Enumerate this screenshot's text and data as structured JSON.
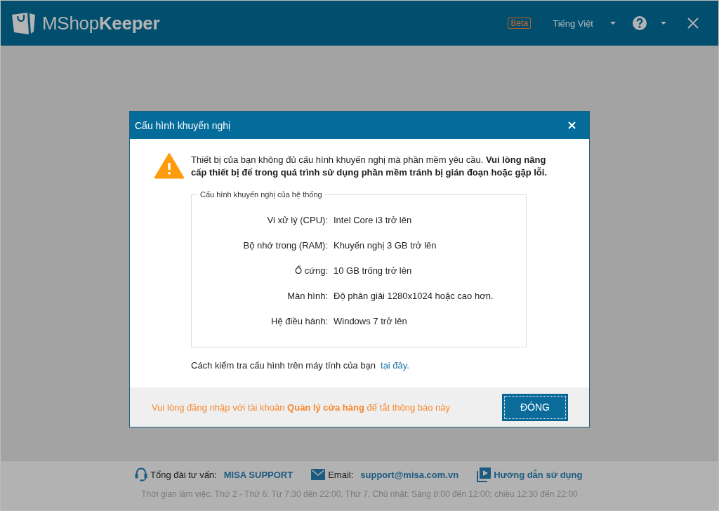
{
  "app_header": {
    "logo_text": "MShop**Keeper**",
    "badge": "Beta",
    "language": "Tiếng Việt"
  },
  "dialog": {
    "title": "Cấu hình khuyến nghị",
    "message": "Thiết bị của bạn không đủ cấu hình khuyến nghị mà phần mềm yêu cầu. **Vui lòng nâng cấp thiết bị để trong quá trình sử dụng phần mềm tránh bị gián đoạn hoặc gặp lỗi.**",
    "requirements": {
      "legend": "Cấu hình khuyến nghị của hệ thống",
      "rows": [
        {
          "label": "Vi xử lý (CPU):",
          "value": "Intel Core i3 trở lên"
        },
        {
          "label": "Bộ nhớ trong (RAM):",
          "value": "Khuyến nghị 3 GB trở lên"
        },
        {
          "label": "Ổ cứng:",
          "value": "10 GB trống trở lên"
        },
        {
          "label": "Màn hình:",
          "value": "Độ phân giải 1280x1024 hoặc cao hơn."
        },
        {
          "label": "Hệ điều hành:",
          "value": "Windows 7 trở lên"
        }
      ]
    },
    "help_text": "Cách kiểm tra cấu hình trên máy tính của bạn",
    "help_link": "tại đây.",
    "footer_note": "Vui lòng đăng nhập với tài khoản **Quản lý cửa hàng** để tắt thông báo này",
    "button": "ĐÓNG"
  },
  "support_bar": {
    "contacts": [
      {
        "kind": "hotline",
        "label": "Tổng đài tư vấn:",
        "value": "MISA SUPPORT"
      },
      {
        "kind": "email",
        "label": "Email:",
        "value": "support@misa.com.vn"
      },
      {
        "kind": "guide",
        "value": "Hướng dẫn sử dụng"
      }
    ],
    "hours": "Thời gian làm việc: Thứ 2 - Thứ 6: Từ 7:30 đến 22:00, Thứ 7, Chủ nhật: Sáng 8:00 đến 12:00; chiều 12:30 đến 22:00"
  }
}
